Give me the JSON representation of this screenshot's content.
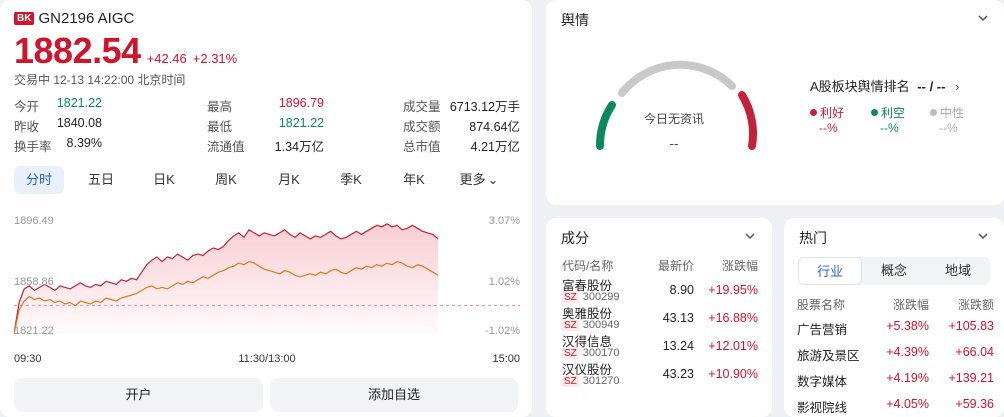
{
  "stock": {
    "badge": "BK",
    "name": "GN2196 AIGC",
    "price": "1882.54",
    "change": "+42.46",
    "change_pct": "+2.31%",
    "status": "交易中 12-13 14:22:00 北京时间"
  },
  "stats": [
    {
      "label": "今开",
      "value": "1821.22",
      "color": "green"
    },
    {
      "label": "最高",
      "value": "1896.79",
      "color": "red"
    },
    {
      "label": "成交量",
      "value": "6713.12万手",
      "color": "dark"
    },
    {
      "label": "昨收",
      "value": "1840.08",
      "color": "dark"
    },
    {
      "label": "最低",
      "value": "1821.22",
      "color": "green"
    },
    {
      "label": "成交额",
      "value": "874.64亿",
      "color": "dark"
    },
    {
      "label": "换手率",
      "value": "8.39%",
      "color": "dark"
    },
    {
      "label": "流通值",
      "value": "1.34万亿",
      "color": "dark"
    },
    {
      "label": "总市值",
      "value": "4.21万亿",
      "color": "dark"
    }
  ],
  "tabs": [
    "分时",
    "五日",
    "日K",
    "周K",
    "月K",
    "季K",
    "年K",
    "更多"
  ],
  "active_tab": 0,
  "chart_data": {
    "type": "line",
    "y_left_labels": [
      "1896.49",
      "1858.86",
      "1821.22"
    ],
    "y_right_labels": [
      "3.07%",
      "1.02%",
      "-1.02%"
    ],
    "x_labels": [
      "09:30",
      "11:30/13:00",
      "15:00"
    ],
    "ylim": [
      1821.22,
      1896.49
    ],
    "prev_close": 1840.08,
    "series": [
      {
        "color": "#c4213a",
        "values": [
          1821.3,
          1842,
          1851,
          1853,
          1850,
          1852,
          1854,
          1852,
          1850,
          1853,
          1852,
          1851,
          1853,
          1855,
          1853,
          1852,
          1854,
          1853,
          1856,
          1855,
          1854,
          1857,
          1856,
          1858,
          1857,
          1862,
          1867,
          1870,
          1872,
          1869,
          1872,
          1871,
          1874,
          1872,
          1870,
          1873,
          1874,
          1873,
          1876,
          1878,
          1877,
          1879,
          1883,
          1886,
          1888,
          1885,
          1890,
          1888,
          1886,
          1888,
          1887,
          1886,
          1888,
          1890,
          1887,
          1885,
          1888,
          1886,
          1884,
          1886,
          1885,
          1887,
          1889,
          1886,
          1884,
          1885,
          1887,
          1889,
          1887,
          1889,
          1891,
          1893,
          1892,
          1894,
          1892,
          1893,
          1890,
          1891,
          1893,
          1891,
          1889,
          1888,
          1887,
          1884
        ]
      },
      {
        "color": "#e07a1f",
        "values": [
          1821.3,
          1837,
          1843,
          1846,
          1844,
          1845,
          1843,
          1844,
          1842,
          1843,
          1841,
          1842,
          1840,
          1843,
          1842,
          1841,
          1843,
          1842,
          1845,
          1844,
          1843,
          1845,
          1846,
          1847,
          1848,
          1850,
          1852,
          1853,
          1851,
          1852,
          1851,
          1853,
          1855,
          1854,
          1856,
          1855,
          1857,
          1859,
          1858,
          1860,
          1862,
          1863,
          1865,
          1866,
          1868,
          1867,
          1869,
          1868,
          1866,
          1864,
          1863,
          1862,
          1861,
          1863,
          1862,
          1860,
          1859,
          1860,
          1861,
          1860,
          1862,
          1861,
          1863,
          1864,
          1862,
          1861,
          1863,
          1865,
          1864,
          1866,
          1865,
          1867,
          1866,
          1868,
          1867,
          1869,
          1868,
          1866,
          1865,
          1867,
          1866,
          1864,
          1862,
          1860
        ]
      }
    ]
  },
  "buttons": {
    "open_account": "开户",
    "add_watch": "添加自选"
  },
  "sentiment": {
    "title": "舆情",
    "gauge_text": "今日无资讯",
    "gauge_value": "--",
    "rank_label": "A股板块舆情排名",
    "rank_value": "-- / --",
    "legend": [
      {
        "label": "利好",
        "pct": "--%",
        "color": "#c4213a"
      },
      {
        "label": "利空",
        "pct": "--%",
        "color": "#0a8a5c"
      },
      {
        "label": "中性",
        "pct": "--%",
        "color": "#bbbbbb"
      }
    ]
  },
  "constituents": {
    "title": "成分",
    "headers": [
      "代码/名称",
      "最新价",
      "涨跌幅"
    ],
    "rows": [
      {
        "name": "富春股份",
        "exchange": "SZ",
        "code": "300299",
        "price": "8.90",
        "change": "+19.95%"
      },
      {
        "name": "奥雅股份",
        "exchange": "SZ",
        "code": "300949",
        "price": "43.13",
        "change": "+16.88%"
      },
      {
        "name": "汉得信息",
        "exchange": "SZ",
        "code": "300170",
        "price": "13.24",
        "change": "+12.01%"
      },
      {
        "name": "汉仪股份",
        "exchange": "SZ",
        "code": "301270",
        "price": "43.23",
        "change": "+10.90%"
      }
    ]
  },
  "hot": {
    "title": "热门",
    "segments": [
      "行业",
      "概念",
      "地域"
    ],
    "active_segment": 0,
    "headers": [
      "股票名称",
      "涨跌幅",
      "涨跌额"
    ],
    "rows": [
      {
        "name": "广告营销",
        "pct": "+5.38%",
        "amount": "+105.83"
      },
      {
        "name": "旅游及景区",
        "pct": "+4.39%",
        "amount": "+66.04"
      },
      {
        "name": "数字媒体",
        "pct": "+4.19%",
        "amount": "+139.21"
      },
      {
        "name": "影视院线",
        "pct": "+4.05%",
        "amount": "+59.36"
      }
    ]
  }
}
